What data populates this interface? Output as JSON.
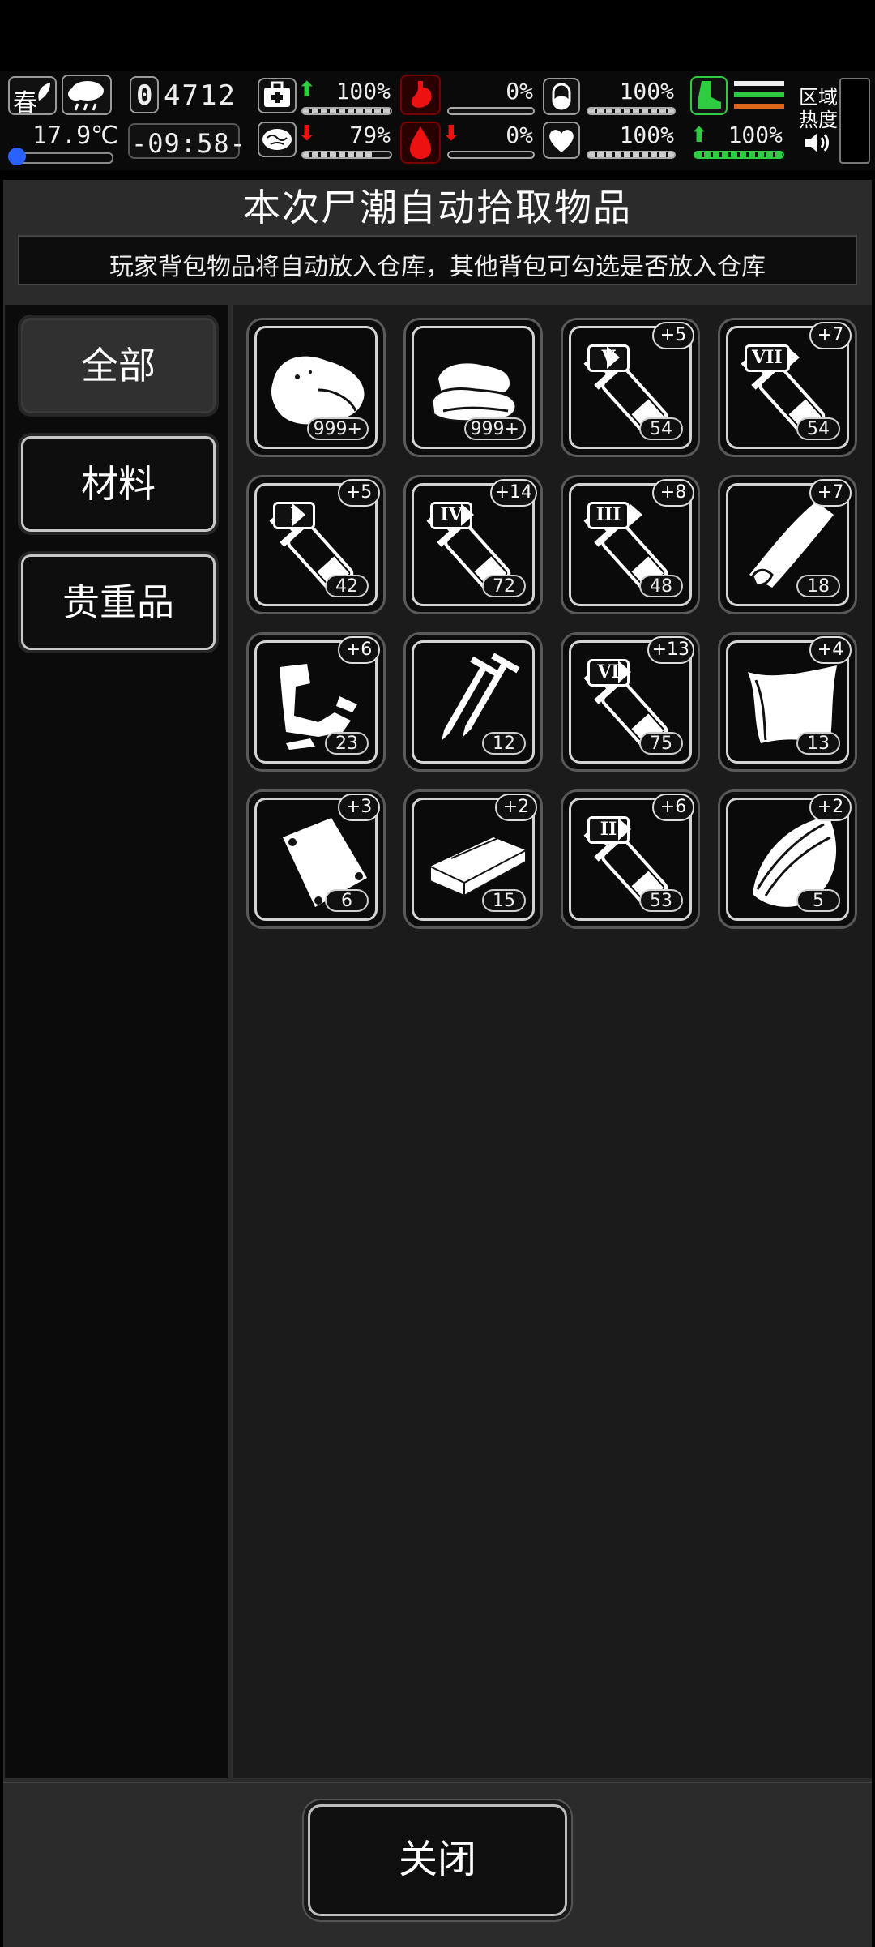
{
  "hud": {
    "season": "春",
    "temperature": "17.9℃",
    "day_digit": "0",
    "day_count": "4712",
    "clock": "-09:58-",
    "health_pct": "100%",
    "mood_pct": "79%",
    "hunger_pct": "0%",
    "bleed_pct": "0%",
    "drink_pct": "100%",
    "heart_pct": "100%",
    "stamina_pct": "100%",
    "zone_label_1": "区域",
    "zone_label_2": "热度"
  },
  "panel": {
    "title": "本次尸潮自动拾取物品",
    "subtitle": "玩家背包物品将自动放入仓库，其他背包可勾选是否放入仓库"
  },
  "tabs": [
    {
      "label": "全部",
      "active": true
    },
    {
      "label": "材料",
      "active": false
    },
    {
      "label": "贵重品",
      "active": false
    }
  ],
  "items": [
    {
      "icon": "meat-icon",
      "count": "999+",
      "bonus": ""
    },
    {
      "icon": "cloth-icon",
      "count": "999+",
      "bonus": ""
    },
    {
      "icon": "syringe-icon",
      "tier": "V",
      "count": "54",
      "bonus": "+5"
    },
    {
      "icon": "syringe-icon",
      "tier": "VII",
      "count": "54",
      "bonus": "+7"
    },
    {
      "icon": "syringe-icon",
      "tier": "I",
      "count": "42",
      "bonus": "+5"
    },
    {
      "icon": "syringe-icon",
      "tier": "IV",
      "count": "72",
      "bonus": "+14"
    },
    {
      "icon": "syringe-icon",
      "tier": "III",
      "count": "48",
      "bonus": "+8"
    },
    {
      "icon": "leather-icon",
      "count": "18",
      "bonus": "+7"
    },
    {
      "icon": "scrap-icon",
      "count": "23",
      "bonus": "+6"
    },
    {
      "icon": "nails-icon",
      "count": "12",
      "bonus": ""
    },
    {
      "icon": "syringe-icon",
      "tier": "VI",
      "count": "75",
      "bonus": "+13"
    },
    {
      "icon": "fabric-icon",
      "count": "13",
      "bonus": "+4"
    },
    {
      "icon": "bag-icon",
      "count": "6",
      "bonus": "+3"
    },
    {
      "icon": "plank-icon",
      "count": "15",
      "bonus": "+2"
    },
    {
      "icon": "syringe-icon",
      "tier": "II",
      "count": "53",
      "bonus": "+6"
    },
    {
      "icon": "wood-icon",
      "count": "5",
      "bonus": "+2"
    }
  ],
  "footer": {
    "close_label": "关闭"
  }
}
